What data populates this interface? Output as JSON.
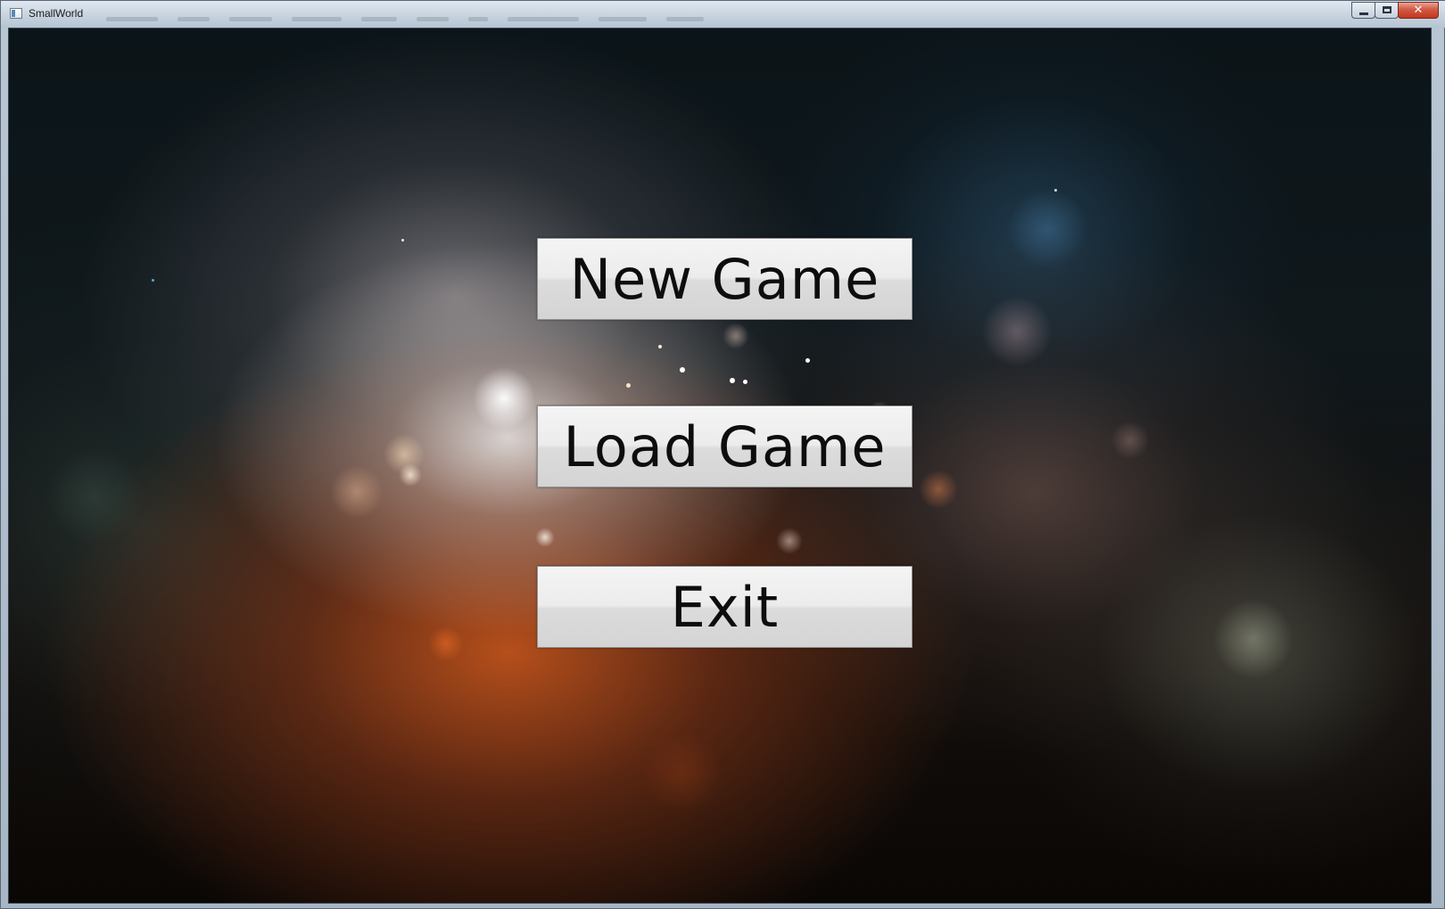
{
  "window": {
    "title": "SmallWorld",
    "controls": {
      "minimize_icon": "minimize-icon",
      "maximize_icon": "maximize-icon",
      "close_icon": "close-icon",
      "close_glyph": "✕"
    }
  },
  "main_menu": {
    "new_game_label": "New Game",
    "load_game_label": "Load Game",
    "exit_label": "Exit"
  },
  "colors": {
    "button_face": "#e6e6e6",
    "button_text": "#0d0d0d",
    "glow_warm": "#d25a1e",
    "glow_white": "#ffffff",
    "background_dark": "#0b1418"
  }
}
